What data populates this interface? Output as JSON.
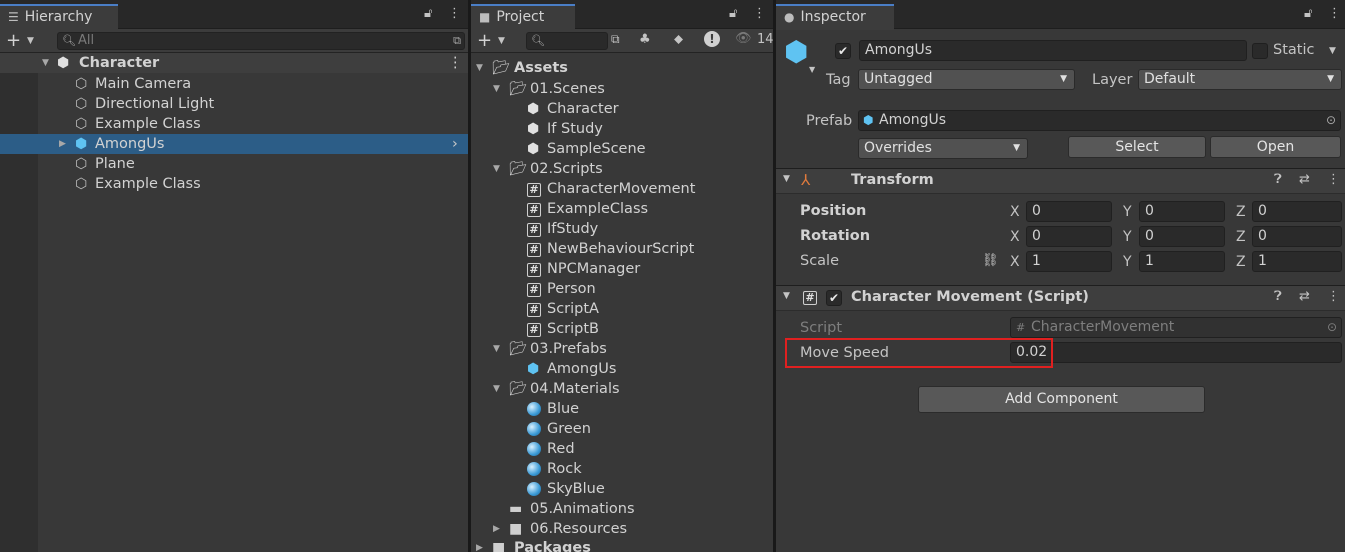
{
  "hierarchy": {
    "tab": "Hierarchy",
    "search_placeholder": "All",
    "scene": "Character",
    "items": [
      {
        "label": "Main Camera"
      },
      {
        "label": "Directional Light"
      },
      {
        "label": "Example Class"
      },
      {
        "label": "AmongUs"
      },
      {
        "label": "Plane"
      },
      {
        "label": "Example Class"
      }
    ]
  },
  "project": {
    "tab": "Project",
    "hidden_count": "14",
    "root": "Assets",
    "scenes_folder": "01.Scenes",
    "scenes": [
      "Character",
      "If Study",
      "SampleScene"
    ],
    "scripts_folder": "02.Scripts",
    "scripts": [
      "CharacterMovement",
      "ExampleClass",
      "IfStudy",
      "NewBehaviourScript",
      "NPCManager",
      "Person",
      "ScriptA",
      "ScriptB"
    ],
    "prefabs_folder": "03.Prefabs",
    "prefabs": [
      "AmongUs"
    ],
    "materials_folder": "04.Materials",
    "materials": [
      "Blue",
      "Green",
      "Red",
      "Rock",
      "SkyBlue"
    ],
    "animations_folder": "05.Animations",
    "resources_folder": "06.Resources",
    "packages": "Packages"
  },
  "inspector": {
    "tab": "Inspector",
    "name": "AmongUs",
    "static_label": "Static",
    "tag_label": "Tag",
    "tag_value": "Untagged",
    "layer_label": "Layer",
    "layer_value": "Default",
    "prefab_label": "Prefab",
    "prefab_value": "AmongUs",
    "overrides": "Overrides",
    "select": "Select",
    "open": "Open",
    "transform": {
      "title": "Transform",
      "position_label": "Position",
      "rotation_label": "Rotation",
      "scale_label": "Scale",
      "position": [
        "0",
        "0",
        "0"
      ],
      "rotation": [
        "0",
        "0",
        "0"
      ],
      "scale": [
        "1",
        "1",
        "1"
      ],
      "axis": [
        "X",
        "Y",
        "Z"
      ]
    },
    "script_component": {
      "title": "Character Movement (Script)",
      "script_label": "Script",
      "script_value": "CharacterMovement",
      "move_speed_label": "Move Speed",
      "move_speed_value": "0.02"
    },
    "add_component": "Add Component"
  },
  "colors": {
    "selection": "#2c5d87",
    "highlight": "#e02020",
    "tab_accent": "#4a7ec6",
    "prefab_blue": "#5fc3f2"
  }
}
